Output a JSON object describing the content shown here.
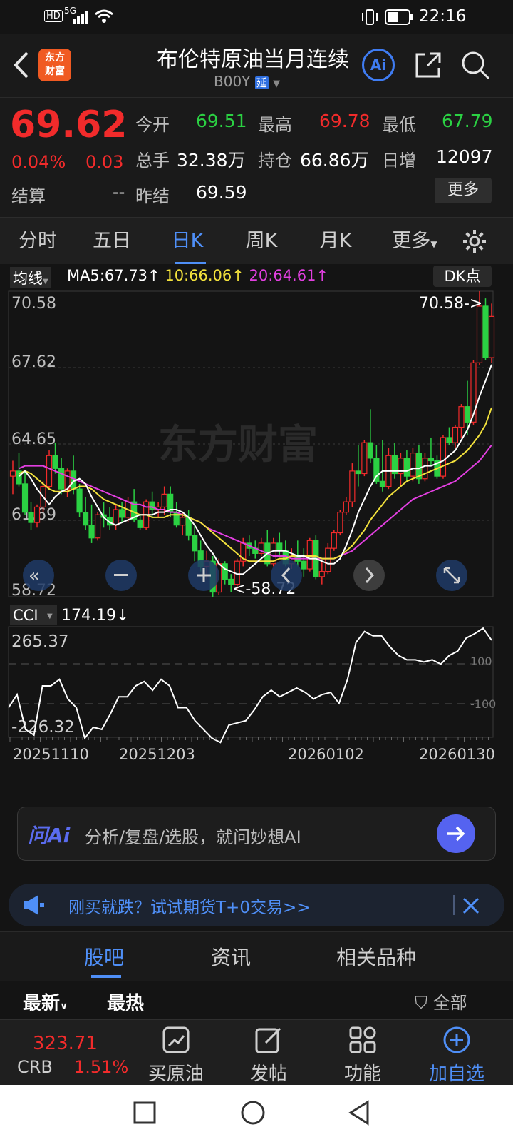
{
  "status": {
    "net": "HD",
    "signal": "5G",
    "time": "22:16"
  },
  "header": {
    "title": "布伦特原油当月连续",
    "code": "B00Y",
    "badge": "延",
    "logo_line1": "东方",
    "logo_line2": "财富",
    "ai_label": "Ai"
  },
  "quote": {
    "price": "69.62",
    "change_pct": "0.04%",
    "change": "0.03",
    "open_label": "今开",
    "open": "69.51",
    "high_label": "最高",
    "high": "69.78",
    "low_label": "最低",
    "low": "67.79",
    "volume_label": "总手",
    "volume": "32.38万",
    "oi_label": "持仓",
    "oi": "66.86万",
    "daily_label": "日增",
    "daily": "12097",
    "settle_label": "结算",
    "settle": "--",
    "prev_label": "昨结",
    "prev": "69.59",
    "more_button": "更多"
  },
  "tabs": [
    "分时",
    "五日",
    "日K",
    "周K",
    "月K",
    "更多"
  ],
  "active_tab": 2,
  "ma": {
    "label": "均线",
    "ma5": "MA5:67.73↑",
    "ma10": "10:66.06↑",
    "ma20": "20:64.61↑",
    "dk": "DK点"
  },
  "axis": {
    "y": [
      "70.58",
      "67.62",
      "64.65",
      "61.69",
      "58.72"
    ],
    "max_marker": "70.58->",
    "min_marker": "<-58.72"
  },
  "watermark": "东方财富",
  "cci": {
    "label": "CCI",
    "value": "174.19↓",
    "y_top": "265.37",
    "y_bottom": "-226.32",
    "ref_high": "100",
    "ref_low": "-100"
  },
  "dates": [
    "20251110",
    "20251203",
    "20260102",
    "20260130"
  ],
  "ai": {
    "logo": "问Ai",
    "placeholder": "分析/复盘/选股，就问妙想AI"
  },
  "ad": {
    "text": "刚买就跌？试试期货T+0交易>>"
  },
  "bottom_tabs": [
    "股吧",
    "资讯",
    "相关品种"
  ],
  "sub": {
    "left1": "最新",
    "left2": "最热",
    "right": "全部"
  },
  "footer": {
    "crb_value": "323.71",
    "crb_label": "CRB",
    "crb_pct": "1.51%",
    "items": [
      "买原油",
      "发帖",
      "功能",
      "加自选"
    ]
  },
  "colors": {
    "up": "#f22b2b",
    "down": "#2bd143",
    "accent": "#4f8ff7",
    "ma5": "#ffffff",
    "ma10": "#f2e13c",
    "ma20": "#e23fe0"
  },
  "chart_data": {
    "type": "candlestick",
    "ylim": [
      58.72,
      70.58
    ],
    "candles": [
      [
        63.4,
        64.0,
        62.7,
        63.6
      ],
      [
        63.6,
        64.3,
        63.0,
        63.1
      ],
      [
        63.1,
        63.6,
        61.9,
        62.0
      ],
      [
        62.0,
        62.4,
        61.3,
        61.6
      ],
      [
        61.6,
        62.3,
        61.4,
        62.2
      ],
      [
        62.2,
        63.2,
        62.0,
        63.0
      ],
      [
        63.0,
        64.4,
        62.9,
        64.2
      ],
      [
        64.2,
        64.7,
        63.5,
        63.7
      ],
      [
        63.7,
        64.1,
        62.7,
        62.9
      ],
      [
        62.9,
        63.7,
        62.6,
        63.6
      ],
      [
        63.6,
        64.2,
        62.7,
        62.9
      ],
      [
        62.9,
        63.1,
        61.8,
        62.0
      ],
      [
        62.0,
        62.6,
        61.3,
        61.5
      ],
      [
        61.5,
        62.3,
        60.8,
        61.0
      ],
      [
        61.0,
        62.0,
        60.9,
        61.9
      ],
      [
        61.9,
        62.4,
        61.4,
        61.8
      ],
      [
        61.8,
        62.2,
        61.3,
        61.5
      ],
      [
        61.5,
        62.3,
        61.3,
        62.1
      ],
      [
        62.1,
        62.4,
        61.6,
        61.8
      ],
      [
        61.8,
        62.6,
        61.6,
        62.4
      ],
      [
        62.4,
        62.9,
        61.6,
        61.7
      ],
      [
        61.7,
        61.9,
        61.3,
        61.4
      ],
      [
        61.4,
        62.5,
        61.3,
        62.4
      ],
      [
        62.4,
        62.8,
        61.8,
        62.1
      ],
      [
        62.1,
        62.4,
        61.8,
        62.2
      ],
      [
        62.2,
        63.0,
        61.9,
        62.7
      ],
      [
        62.7,
        63.0,
        61.8,
        62.0
      ],
      [
        62.0,
        62.4,
        61.4,
        61.5
      ],
      [
        61.5,
        62.0,
        61.1,
        61.8
      ],
      [
        61.8,
        62.1,
        60.9,
        61.1
      ],
      [
        61.1,
        61.5,
        60.1,
        60.5
      ],
      [
        60.5,
        60.9,
        59.7,
        59.9
      ],
      [
        59.9,
        60.5,
        59.4,
        60.1
      ],
      [
        60.1,
        60.3,
        58.72,
        58.9
      ],
      [
        58.9,
        60.2,
        58.8,
        60.0
      ],
      [
        60.0,
        60.1,
        59.2,
        59.4
      ],
      [
        59.4,
        59.6,
        58.9,
        59.2
      ],
      [
        59.2,
        60.2,
        59.0,
        60.1
      ],
      [
        60.1,
        61.0,
        59.9,
        60.8
      ],
      [
        60.8,
        61.1,
        60.3,
        60.6
      ],
      [
        60.6,
        60.9,
        60.2,
        60.4
      ],
      [
        60.4,
        61.0,
        60.3,
        60.8
      ],
      [
        60.8,
        61.3,
        59.9,
        60.0
      ],
      [
        60.0,
        61.0,
        59.9,
        60.8
      ],
      [
        60.8,
        61.2,
        60.3,
        60.5
      ],
      [
        60.5,
        60.9,
        59.9,
        60.0
      ],
      [
        60.0,
        60.6,
        59.8,
        60.3
      ],
      [
        60.3,
        60.9,
        59.9,
        60.1
      ],
      [
        60.1,
        60.6,
        59.5,
        59.8
      ],
      [
        59.8,
        61.0,
        59.7,
        60.9
      ],
      [
        60.9,
        61.1,
        59.4,
        59.5
      ],
      [
        59.5,
        60.1,
        59.2,
        59.7
      ],
      [
        59.7,
        60.8,
        59.6,
        60.6
      ],
      [
        60.6,
        61.3,
        60.5,
        61.2
      ],
      [
        61.2,
        62.1,
        61.1,
        62.0
      ],
      [
        62.0,
        62.6,
        61.9,
        62.4
      ],
      [
        62.4,
        63.9,
        62.2,
        63.6
      ],
      [
        63.6,
        64.6,
        63.0,
        63.5
      ],
      [
        63.5,
        64.8,
        63.4,
        64.7
      ],
      [
        64.7,
        66.0,
        63.9,
        64.1
      ],
      [
        64.1,
        64.6,
        63.1,
        63.2
      ],
      [
        63.2,
        64.8,
        62.8,
        63.0
      ],
      [
        63.0,
        64.5,
        62.9,
        64.2
      ],
      [
        64.2,
        64.7,
        63.3,
        63.5
      ],
      [
        63.5,
        64.3,
        63.0,
        64.1
      ],
      [
        64.1,
        64.4,
        63.2,
        63.4
      ],
      [
        63.4,
        64.5,
        63.2,
        64.3
      ],
      [
        64.3,
        64.6,
        63.1,
        63.3
      ],
      [
        63.3,
        64.3,
        63.2,
        64.1
      ],
      [
        64.1,
        64.9,
        63.8,
        64.0
      ],
      [
        64.0,
        64.2,
        63.3,
        63.4
      ],
      [
        63.4,
        65.0,
        63.3,
        64.9
      ],
      [
        64.9,
        65.3,
        64.6,
        64.7
      ],
      [
        64.7,
        65.4,
        64.5,
        65.3
      ],
      [
        65.3,
        66.2,
        64.9,
        66.1
      ],
      [
        66.1,
        67.1,
        65.0,
        65.5
      ],
      [
        65.5,
        67.9,
        65.4,
        67.8
      ],
      [
        67.8,
        70.58,
        67.7,
        70.0
      ],
      [
        70.0,
        70.3,
        67.9,
        68.0
      ],
      [
        68.0,
        70.1,
        67.8,
        69.6
      ]
    ],
    "ma5": [
      63.4,
      63.6,
      63.3,
      62.9,
      62.6,
      62.3,
      62.6,
      62.8,
      62.9,
      63.2,
      63.3,
      63.1,
      62.6,
      62.2,
      61.8,
      61.6,
      61.5,
      61.6,
      61.7,
      61.8,
      61.9,
      61.9,
      61.9,
      62.0,
      62.0,
      62.1,
      62.1,
      62.0,
      61.8,
      61.5,
      61.1,
      60.7,
      60.4,
      60.0,
      59.8,
      59.7,
      59.6,
      59.6,
      59.8,
      60.0,
      60.2,
      60.4,
      60.5,
      60.5,
      60.5,
      60.4,
      60.3,
      60.3,
      60.2,
      60.2,
      60.1,
      60.0,
      60.0,
      60.2,
      60.7,
      61.3,
      62.0,
      62.5,
      63.0,
      63.4,
      63.6,
      63.6,
      63.6,
      63.6,
      63.6,
      63.7,
      63.7,
      63.8,
      63.8,
      63.9,
      64.0,
      64.2,
      64.4,
      64.8,
      65.2,
      65.8,
      66.5,
      67.1,
      67.73
    ],
    "ma10": [
      63.5,
      63.6,
      63.5,
      63.3,
      63.1,
      62.9,
      62.8,
      62.8,
      62.8,
      62.9,
      63.0,
      63.0,
      62.9,
      62.7,
      62.5,
      62.4,
      62.3,
      62.2,
      62.1,
      62.0,
      61.9,
      61.9,
      61.8,
      61.8,
      61.8,
      61.9,
      61.9,
      61.9,
      61.8,
      61.7,
      61.6,
      61.4,
      61.2,
      61.0,
      60.8,
      60.6,
      60.4,
      60.2,
      60.1,
      60.1,
      60.1,
      60.1,
      60.1,
      60.2,
      60.2,
      60.3,
      60.3,
      60.3,
      60.3,
      60.3,
      60.2,
      60.2,
      60.2,
      60.3,
      60.5,
      60.7,
      61.0,
      61.3,
      61.7,
      62.0,
      62.3,
      62.6,
      62.8,
      63.0,
      63.2,
      63.3,
      63.4,
      63.5,
      63.6,
      63.7,
      63.8,
      63.9,
      64.0,
      64.2,
      64.4,
      64.7,
      65.0,
      65.4,
      66.06
    ],
    "ma20": [
      63.7,
      63.8,
      63.8,
      63.8,
      63.8,
      63.7,
      63.6,
      63.5,
      63.4,
      63.3,
      63.2,
      63.1,
      63.0,
      62.9,
      62.8,
      62.7,
      62.6,
      62.5,
      62.4,
      62.3,
      62.3,
      62.2,
      62.2,
      62.1,
      62.1,
      62.0,
      62.0,
      61.9,
      61.8,
      61.7,
      61.6,
      61.4,
      61.3,
      61.2,
      61.1,
      61.0,
      60.9,
      60.8,
      60.7,
      60.6,
      60.5,
      60.4,
      60.3,
      60.3,
      60.3,
      60.2,
      60.2,
      60.2,
      60.2,
      60.2,
      60.2,
      60.2,
      60.2,
      60.3,
      60.4,
      60.5,
      60.7,
      60.9,
      61.1,
      61.3,
      61.5,
      61.7,
      61.9,
      62.1,
      62.3,
      62.5,
      62.6,
      62.7,
      62.8,
      62.9,
      63.0,
      63.1,
      63.2,
      63.4,
      63.6,
      63.8,
      64.0,
      64.3,
      64.61
    ],
    "cci": [
      -100,
      -40,
      -200,
      -226,
      0,
      0,
      30,
      -60,
      -100,
      -240,
      -190,
      -200,
      -130,
      -50,
      -50,
      0,
      20,
      -20,
      30,
      0,
      -100,
      -100,
      -160,
      -200,
      -240,
      -260,
      -180,
      -170,
      -160,
      -110,
      -50,
      -20,
      -50,
      -30,
      -10,
      -30,
      -60,
      -40,
      -30,
      -80,
      30,
      200,
      250,
      230,
      230,
      180,
      140,
      120,
      120,
      110,
      120,
      100,
      140,
      160,
      220,
      240,
      265,
      210
    ]
  }
}
